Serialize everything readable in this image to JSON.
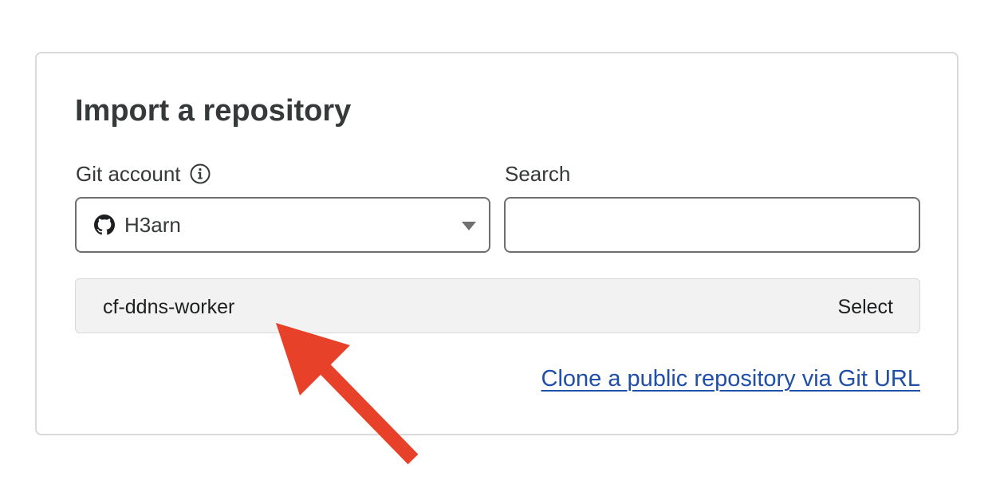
{
  "card": {
    "title": "Import a repository"
  },
  "git_account": {
    "label": "Git account",
    "selected": "H3arn"
  },
  "search": {
    "label": "Search",
    "value": "",
    "placeholder": ""
  },
  "repository": {
    "name": "cf-ddns-worker",
    "select_label": "Select"
  },
  "clone_link": {
    "label": "Clone a public repository via Git URL"
  },
  "colors": {
    "link": "#1f4fa8",
    "annotation_arrow": "#e8412a",
    "row_background": "#f2f2f2"
  },
  "icons": [
    "info-icon",
    "github-icon",
    "chevron-down-icon",
    "annotation-arrow"
  ]
}
